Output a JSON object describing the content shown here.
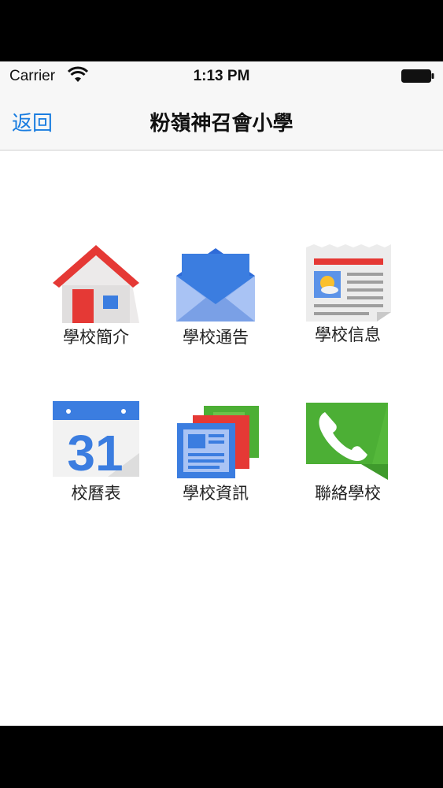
{
  "status_bar": {
    "carrier": "Carrier",
    "time": "1:13 PM"
  },
  "nav": {
    "back_label": "返回",
    "title": "粉嶺神召會小學"
  },
  "menu": [
    {
      "label": "學校簡介",
      "icon": "house-icon"
    },
    {
      "label": "學校通告",
      "icon": "envelope-icon"
    },
    {
      "label": "學校信息",
      "icon": "newspaper-icon"
    },
    {
      "label": "校曆表",
      "icon": "calendar-icon",
      "icon_text": "31"
    },
    {
      "label": "學校資訊",
      "icon": "documents-icon"
    },
    {
      "label": "聯絡學校",
      "icon": "phone-icon"
    }
  ],
  "colors": {
    "accent": "#1a7de0",
    "red": "#e53935",
    "blue": "#3b7de0",
    "green": "#4caf35"
  }
}
